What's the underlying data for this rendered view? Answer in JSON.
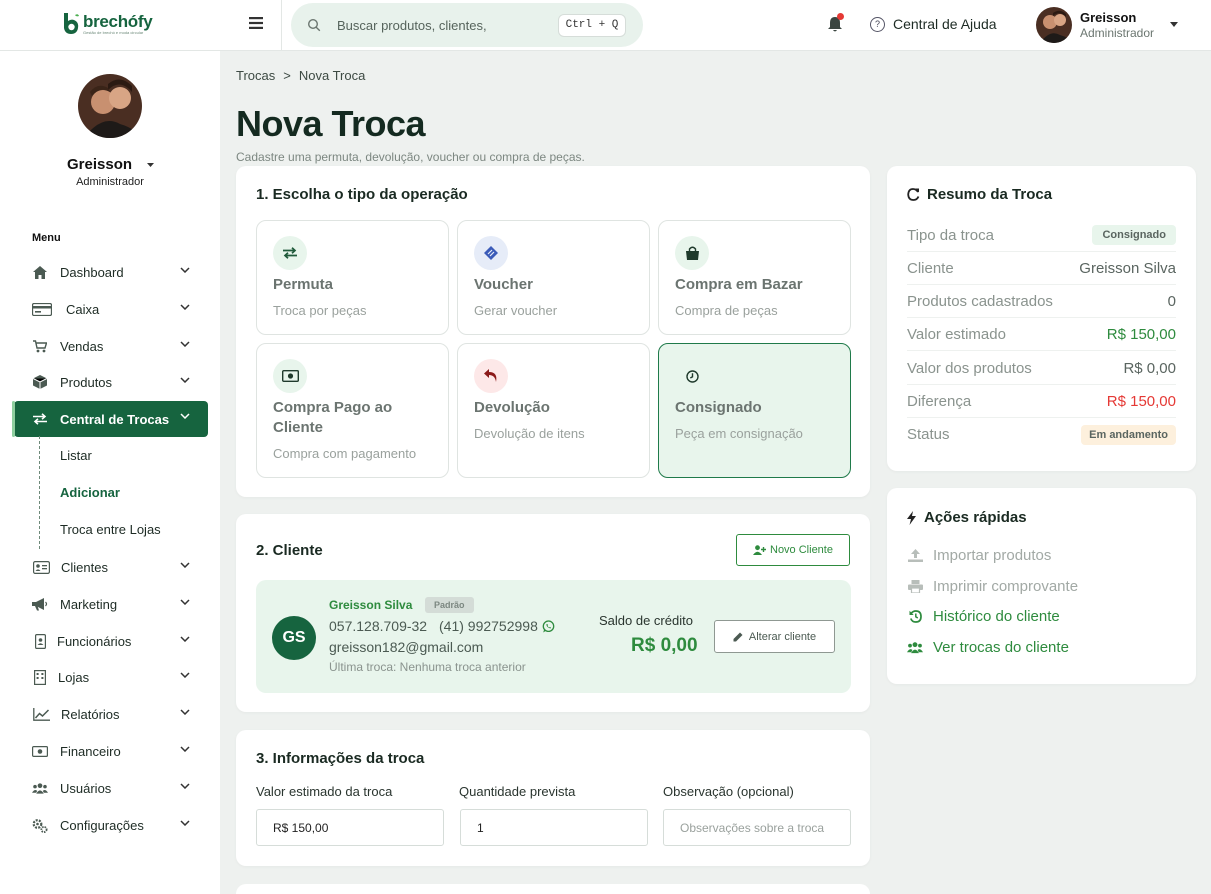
{
  "app": {
    "logo_text": "brechófy",
    "logo_tagline": "Gestão de brechó e moda circular"
  },
  "header": {
    "search_placeholder": "Buscar produtos, clientes,",
    "shortcut": "Ctrl + Q",
    "help_label": "Central de Ajuda",
    "user_name": "Greisson",
    "user_role": "Administrador"
  },
  "sidebar": {
    "user_name": "Greisson",
    "user_role": "Administrador",
    "menu_label": "Menu",
    "items": [
      {
        "label": "Dashboard",
        "icon": "home-icon"
      },
      {
        "label": "Caixa",
        "icon": "card-icon"
      },
      {
        "label": "Vendas",
        "icon": "cart-icon"
      },
      {
        "label": "Produtos",
        "icon": "box-icon"
      },
      {
        "label": "Central de Trocas",
        "icon": "exchange-icon"
      },
      {
        "label": "Clientes",
        "icon": "id-card-icon"
      },
      {
        "label": "Marketing",
        "icon": "megaphone-icon"
      },
      {
        "label": "Funcionários",
        "icon": "badge-icon"
      },
      {
        "label": "Lojas",
        "icon": "building-icon"
      },
      {
        "label": "Relatórios",
        "icon": "chart-icon"
      },
      {
        "label": "Financeiro",
        "icon": "money-icon"
      },
      {
        "label": "Usuários",
        "icon": "users-icon"
      },
      {
        "label": "Configurações",
        "icon": "gears-icon"
      }
    ],
    "sub_items": [
      "Listar",
      "Adicionar",
      "Troca entre Lojas"
    ]
  },
  "breadcrumb": {
    "root": "Trocas",
    "sep": ">",
    "current": "Nova Troca"
  },
  "page": {
    "title": "Nova Troca",
    "subtitle": "Cadastre uma permuta, devolução, voucher ou compra de peças."
  },
  "operation": {
    "title": "1. Escolha o tipo da operação",
    "options": [
      {
        "title": "Permuta",
        "subtitle": "Troca por peças"
      },
      {
        "title": "Voucher",
        "subtitle": "Gerar voucher"
      },
      {
        "title": "Compra em Bazar",
        "subtitle": "Compra de peças"
      },
      {
        "title": "Compra Pago ao Cliente",
        "subtitle": "Compra com pagamento"
      },
      {
        "title": "Devolução",
        "subtitle": "Devolução de itens"
      },
      {
        "title": "Consignado",
        "subtitle": "Peça em consignação"
      }
    ],
    "selected": "Consignado"
  },
  "client": {
    "title": "2. Cliente",
    "new_button": "Novo Cliente",
    "initials": "GS",
    "name": "Greisson Silva",
    "badge": "Padrão",
    "document": "057.128.709-32",
    "phone": "(41) 992752998",
    "email": "greisson182@gmail.com",
    "last_exchange": "Última troca: Nenhuma troca anterior",
    "credit_label": "Saldo de crédito",
    "credit_value": "R$ 0,00",
    "change_button": "Alterar cliente"
  },
  "info": {
    "title": "3. Informações da troca",
    "value_label": "Valor estimado da troca",
    "value": "R$ 150,00",
    "qty_label": "Quantidade prevista",
    "qty": "1",
    "obs_label": "Observação (opcional)",
    "obs_placeholder": "Observações sobre a troca"
  },
  "summary": {
    "title": "Resumo da Troca",
    "rows": [
      {
        "label": "Tipo da troca",
        "value": "Consignado"
      },
      {
        "label": "Cliente",
        "value": "Greisson Silva"
      },
      {
        "label": "Produtos cadastrados",
        "value": "0"
      },
      {
        "label": "Valor estimado",
        "value": "R$ 150,00"
      },
      {
        "label": "Valor dos produtos",
        "value": "R$ 0,00"
      },
      {
        "label": "Diferença",
        "value": "R$ 150,00"
      },
      {
        "label": "Status",
        "value": "Em andamento"
      }
    ]
  },
  "quick": {
    "title": "Ações rápidas",
    "actions": [
      {
        "label": "Importar produtos",
        "enabled": false
      },
      {
        "label": "Imprimir comprovante",
        "enabled": false
      },
      {
        "label": "Histórico do cliente",
        "enabled": true
      },
      {
        "label": "Ver trocas do cliente",
        "enabled": true
      }
    ]
  },
  "colors": {
    "primary": "#16643f",
    "accent": "#2e8b3e",
    "danger": "#e53935",
    "warning_bg": "#fdf0dd"
  }
}
